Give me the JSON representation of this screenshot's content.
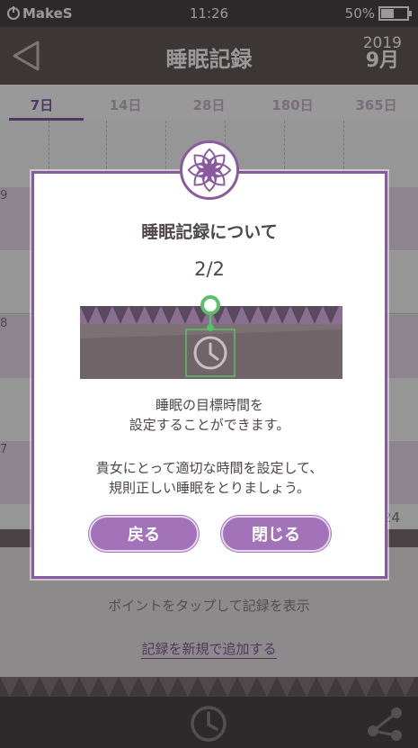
{
  "status_bar": {
    "carrier": "MakeS",
    "time": "11:26",
    "battery": "50%",
    "battery_level": 0.5
  },
  "header": {
    "title": "睡眠記録",
    "year": "2019",
    "month": "9月"
  },
  "tabs": [
    {
      "label": "7日",
      "active": true
    },
    {
      "label": "14日",
      "active": false
    },
    {
      "label": "28日",
      "active": false
    },
    {
      "label": "180日",
      "active": false
    },
    {
      "label": "365日",
      "active": false
    }
  ],
  "chart": {
    "y_labels": [
      "9",
      "8",
      "7"
    ],
    "x_label_right": "24"
  },
  "hint_text": "ポイントをタップして記録を表示",
  "add_record_link": "記録を新規で追加する",
  "dialog": {
    "title": "睡眠記録について",
    "page": "2/2",
    "text1_line1": "睡眠の目標時間を",
    "text1_line2": "設定することができます。",
    "text2_line1": "貴女にとって適切な時間を設定して、",
    "text2_line2": "規則正しい睡眠をとりましょう。",
    "back_button": "戻る",
    "close_button": "閉じる"
  },
  "colors": {
    "accent": "#8a5a9e",
    "button": "#a273b8",
    "dark": "#4e4648",
    "green": "#5cbf6a"
  }
}
